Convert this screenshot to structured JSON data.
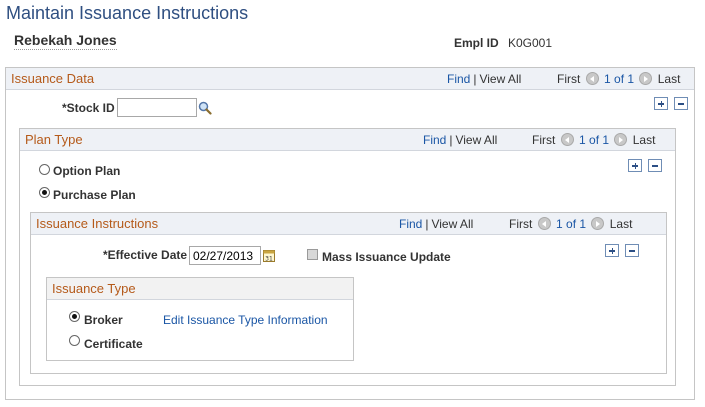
{
  "page": {
    "title": "Maintain Issuance Instructions"
  },
  "employee": {
    "name": "Rebekah Jones",
    "emplid_label": "Empl ID",
    "emplid_value": "K0G001"
  },
  "issuance_data": {
    "title": "Issuance Data",
    "nav": {
      "find": "Find",
      "view_all": "View All",
      "first": "First",
      "count": "1 of 1",
      "last": "Last"
    },
    "stock_id_label": "*Stock ID",
    "stock_id_value": ""
  },
  "plan_type": {
    "title": "Plan Type",
    "nav": {
      "find": "Find",
      "view_all": "View All",
      "first": "First",
      "count": "1 of 1",
      "last": "Last"
    },
    "options": [
      {
        "label": "Option Plan",
        "selected": false
      },
      {
        "label": "Purchase Plan",
        "selected": true
      }
    ]
  },
  "issuance_instructions": {
    "title": "Issuance Instructions",
    "nav": {
      "find": "Find",
      "view_all": "View All",
      "first": "First",
      "count": "1 of 1",
      "last": "Last"
    },
    "effective_date_label": "*Effective Date",
    "effective_date_value": "02/27/2013",
    "mass_update_label": "Mass Issuance Update",
    "mass_update_checked": false
  },
  "issuance_type": {
    "title": "Issuance Type",
    "options": [
      {
        "label": "Broker",
        "selected": true
      },
      {
        "label": "Certificate",
        "selected": false
      }
    ],
    "edit_link": "Edit Issuance Type Information"
  }
}
